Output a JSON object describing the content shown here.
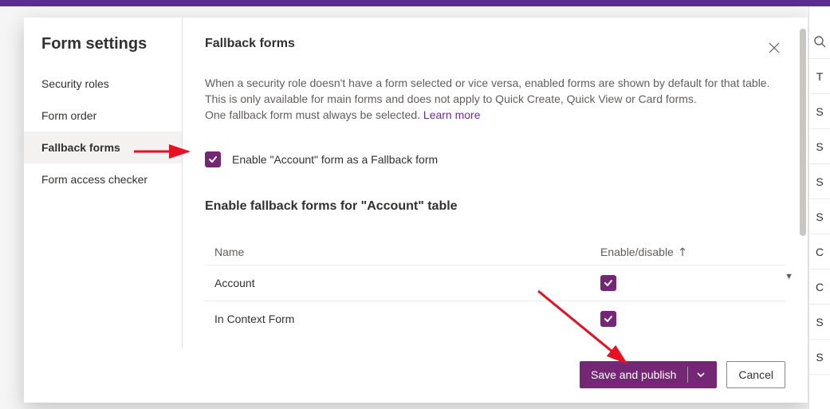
{
  "sidebar": {
    "title": "Form settings",
    "items": [
      {
        "label": "Security roles"
      },
      {
        "label": "Form order"
      },
      {
        "label": "Fallback forms"
      },
      {
        "label": "Form access checker"
      }
    ],
    "active_index": 2
  },
  "content": {
    "title": "Fallback forms",
    "desc_line1": "When a security role doesn't have a form selected or vice versa, enabled forms are shown by default for that table.",
    "desc_line2": "This is only available for main forms and does not apply to Quick Create, Quick View or Card forms.",
    "desc_line3_prefix": "One fallback form must always be selected. ",
    "learn_more": "Learn more",
    "enable_label": "Enable \"Account\" form as a Fallback form",
    "enable_checked": true,
    "section_title": "Enable fallback forms for \"Account\" table",
    "table": {
      "header_name": "Name",
      "header_enable": "Enable/disable",
      "rows": [
        {
          "name": "Account",
          "enabled": true
        },
        {
          "name": "In Context Form",
          "enabled": true
        }
      ]
    }
  },
  "footer": {
    "primary_label": "Save and publish",
    "cancel_label": "Cancel"
  },
  "right_strip": [
    "T",
    "S",
    "S",
    "S",
    "S",
    "C",
    "C",
    "S",
    "S"
  ]
}
